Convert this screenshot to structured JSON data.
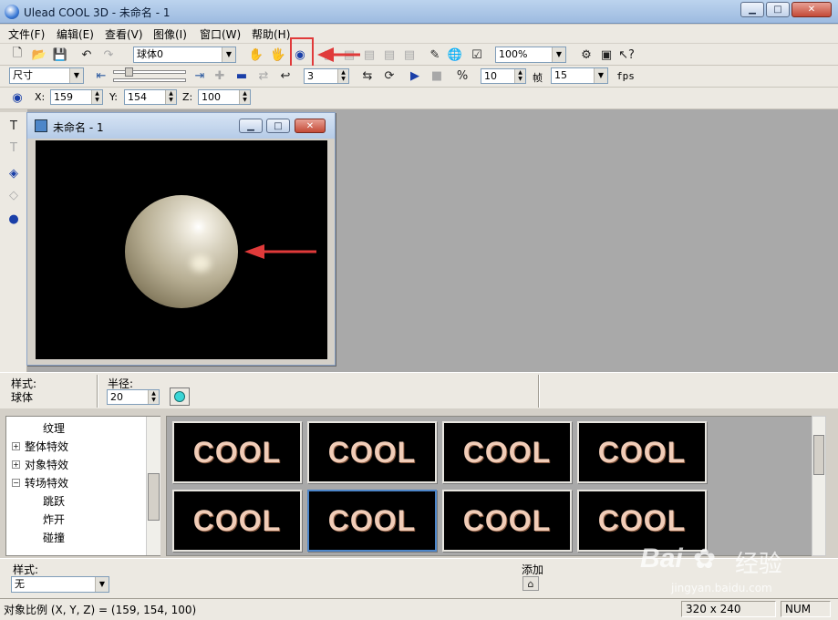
{
  "window": {
    "title": "Ulead COOL 3D - 未命名 - 1",
    "min": "▁",
    "max": "□",
    "close": "✕"
  },
  "menu": [
    "文件(F)",
    "编辑(E)",
    "查看(V)",
    "图像(I)",
    "窗口(W)",
    "帮助(H)"
  ],
  "toolbar1": {
    "object_select": "球体0",
    "zoom": "100%"
  },
  "toolbar2": {
    "mode": "尺寸",
    "steps": "3",
    "frame": "10",
    "frame_label": "帧",
    "fps_value": "15",
    "fps_label": "fps"
  },
  "toolbar3": {
    "x_label": "X:",
    "x": "159",
    "y_label": "Y:",
    "y": "154",
    "z_label": "Z:",
    "z": "100"
  },
  "document": {
    "title": "未命名 - 1"
  },
  "props": {
    "style_label": "样式:",
    "style_value": "球体",
    "radius_label": "半径:",
    "radius": "20"
  },
  "tree": {
    "items": [
      {
        "label": "纹理"
      },
      {
        "label": "整体特效",
        "exp": "+"
      },
      {
        "label": "对象特效",
        "exp": "+"
      },
      {
        "label": "转场特效",
        "exp": "−"
      },
      {
        "label": "跳跃"
      },
      {
        "label": "炸开"
      },
      {
        "label": "碰撞"
      }
    ]
  },
  "thumbnails": [
    "COOL",
    "COOL",
    "COOL",
    "COOL",
    "COOL",
    "COOL",
    "COOL",
    "COOL"
  ],
  "bottom": {
    "style_label": "样式:",
    "style_value": "无",
    "add_label": "添加"
  },
  "status": {
    "text": "对象比例 (X, Y, Z) = (159, 154, 100)",
    "size": "320 x 240",
    "num": "NUM"
  },
  "watermark": {
    "brand": "Bai",
    "brand2": "经验",
    "url": "jingyan.baidu.com"
  },
  "colors": {
    "annotation": "#e03a3a",
    "canvas": "#000000",
    "workspace": "#a9a9a9"
  }
}
